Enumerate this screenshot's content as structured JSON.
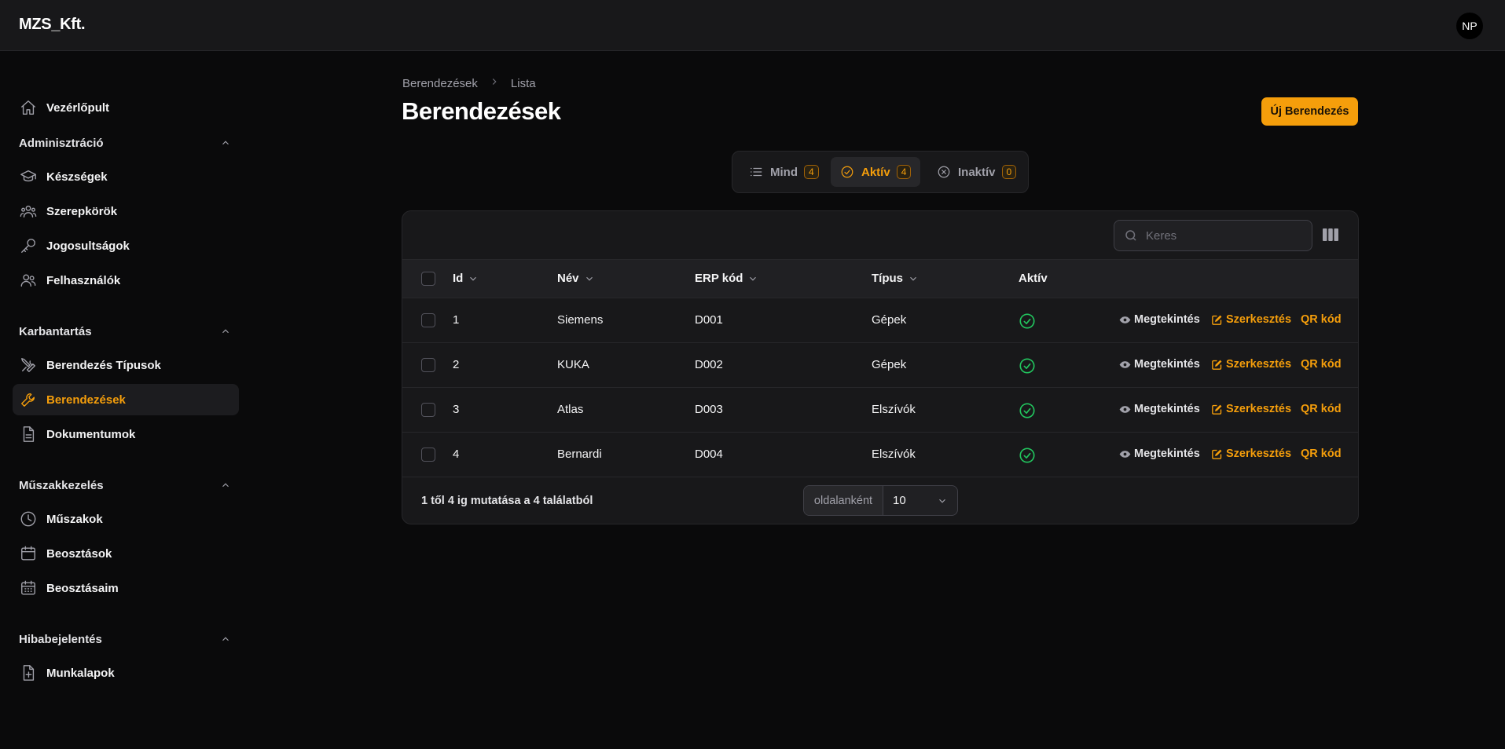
{
  "app": {
    "brand": "MZS_Kft.",
    "user_initials": "NP"
  },
  "sidebar": {
    "dashboard": {
      "label": "Vezérlőpult",
      "icon": "home-icon"
    },
    "groups": [
      {
        "label": "Adminisztráció",
        "items": [
          {
            "label": "Készségek",
            "icon": "academic-cap-icon"
          },
          {
            "label": "Szerepkörök",
            "icon": "user-group-icon"
          },
          {
            "label": "Jogosultságok",
            "icon": "key-icon"
          },
          {
            "label": "Felhasználók",
            "icon": "users-icon"
          }
        ]
      },
      {
        "label": "Karbantartás",
        "items": [
          {
            "label": "Berendezés Típusok",
            "icon": "wrench-screwdriver-icon"
          },
          {
            "label": "Berendezések",
            "icon": "wrench-icon",
            "active": true
          },
          {
            "label": "Dokumentumok",
            "icon": "document-icon"
          }
        ]
      },
      {
        "label": "Műszakkezelés",
        "items": [
          {
            "label": "Műszakok",
            "icon": "clock-icon"
          },
          {
            "label": "Beosztások",
            "icon": "calendar-icon"
          },
          {
            "label": "Beosztásaim",
            "icon": "calendar-days-icon"
          }
        ]
      },
      {
        "label": "Hibabejelentés",
        "items": [
          {
            "label": "Munkalapok",
            "icon": "document-plus-icon"
          }
        ]
      }
    ]
  },
  "breadcrumb": [
    "Berendezések",
    "Lista"
  ],
  "page": {
    "title": "Berendezések",
    "new_button": "Új Berendezés"
  },
  "tabs": [
    {
      "label": "Mind",
      "count": "4"
    },
    {
      "label": "Aktív",
      "count": "4",
      "active": true
    },
    {
      "label": "Inaktív",
      "count": "0"
    }
  ],
  "table": {
    "search_placeholder": "Keres",
    "columns": [
      "Id",
      "Név",
      "ERP kód",
      "Típus",
      "Aktív"
    ],
    "rows": [
      {
        "id": "1",
        "name": "Siemens",
        "erp": "D001",
        "type": "Gépek",
        "active": true
      },
      {
        "id": "2",
        "name": "KUKA",
        "erp": "D002",
        "type": "Gépek",
        "active": true
      },
      {
        "id": "3",
        "name": "Atlas",
        "erp": "D003",
        "type": "Elszívók",
        "active": true
      },
      {
        "id": "4",
        "name": "Bernardi",
        "erp": "D004",
        "type": "Elszívók",
        "active": true
      }
    ],
    "actions": {
      "view": "Megtekintés",
      "edit": "Szerkesztés",
      "qr": "QR kód"
    },
    "footer": {
      "summary": "1 től 4 ig mutatása a 4 találatból",
      "per_page_label": "oldalanként",
      "per_page_value": "10"
    }
  },
  "colors": {
    "accent": "#f59e0b",
    "success": "#22c55e",
    "background": "#0a0a0b"
  }
}
